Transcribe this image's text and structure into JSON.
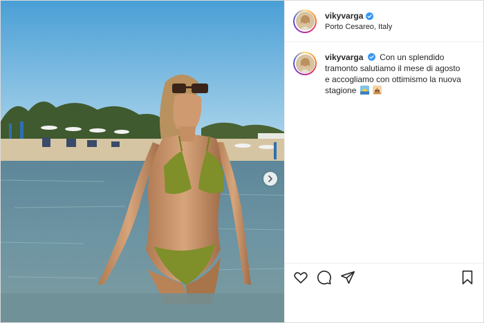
{
  "post": {
    "username": "vikyvarga",
    "location": "Porto Cesareo, Italy",
    "caption": "Con un splendido tramonto salutiamo il mese di agosto e accogliamo con ottimismo la nuova stagione",
    "caption_emojis": [
      "sunrise-emoji",
      "family-emoji"
    ],
    "verified": true
  },
  "icons": {
    "like": "heart-icon",
    "comment": "comment-icon",
    "share": "paper-plane-icon",
    "save": "bookmark-icon",
    "next": "chevron-right-icon"
  },
  "colors": {
    "accent_verified": "#3897f0",
    "border": "#dbdbdb",
    "text": "#262626"
  }
}
